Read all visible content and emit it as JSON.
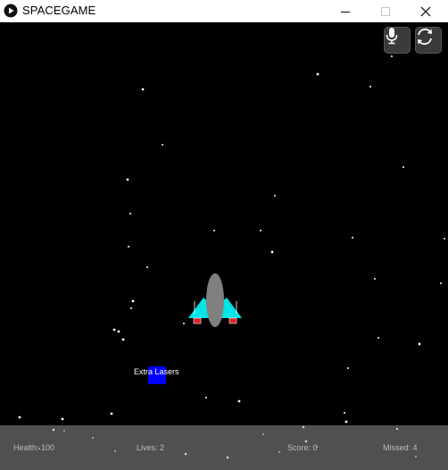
{
  "window": {
    "title": "SPACEGAME",
    "app_icon": "play-circle-icon",
    "controls": [
      "minimize-icon",
      "maximize-icon",
      "close-icon"
    ]
  },
  "game": {
    "background_color": "#000000",
    "ship": {
      "body_color": "#808080",
      "wing_color": "#00e5e5",
      "thruster_color": "#e02020"
    },
    "powerup": {
      "label": "Extra Lasers",
      "color": "#0000ff"
    },
    "buttons": {
      "mic_icon": "microphone-icon",
      "restart_icon": "restart-icon"
    }
  },
  "hud": {
    "background_color": "#505050",
    "health": "Health: 100",
    "lives": "Lives: 2",
    "score": "Score: 0",
    "missed": "Missed: 4"
  }
}
